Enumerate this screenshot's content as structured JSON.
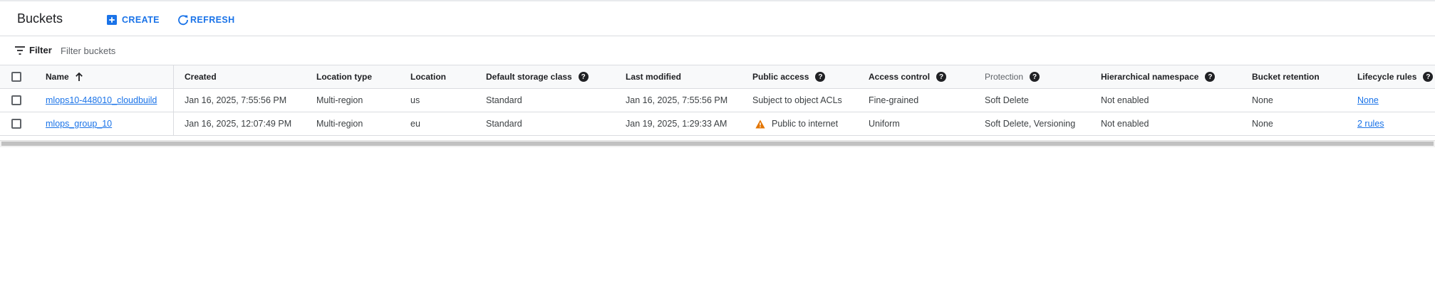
{
  "header": {
    "title": "Buckets",
    "create_label": "CREATE",
    "refresh_label": "REFRESH"
  },
  "filter": {
    "label": "Filter",
    "placeholder": "Filter buckets"
  },
  "table": {
    "columns": [
      "Name",
      "Created",
      "Location type",
      "Location",
      "Default storage class",
      "Last modified",
      "Public access",
      "Access control",
      "Protection",
      "Hierarchical namespace",
      "Bucket retention",
      "Lifecycle rules"
    ],
    "sorted_column": "Name",
    "sort_direction": "ascending",
    "rows": [
      {
        "name": "mlops10-448010_cloudbuild",
        "created": "Jan 16, 2025, 7:55:56 PM",
        "location_type": "Multi-region",
        "location": "us",
        "storage_class": "Standard",
        "last_modified": "Jan 16, 2025, 7:55:56 PM",
        "public_access": "Subject to object ACLs",
        "access_control": "Fine-grained",
        "protection": "Soft Delete",
        "hierarchical_namespace": "Not enabled",
        "bucket_retention": "None",
        "lifecycle_rules": "None"
      },
      {
        "name": "mlops_group_10",
        "created": "Jan 16, 2025, 12:07:49 PM",
        "location_type": "Multi-region",
        "location": "eu",
        "storage_class": "Standard",
        "last_modified": "Jan 19, 2025, 1:29:33 AM",
        "public_access": "Public to internet",
        "access_control": "Uniform",
        "protection": "Soft Delete, Versioning",
        "hierarchical_namespace": "Not enabled",
        "bucket_retention": "None",
        "lifecycle_rules": "2 rules"
      }
    ]
  },
  "colors": {
    "accent": "#1a73e8",
    "warning": "#e37400",
    "border": "#dadce0"
  },
  "icons": {
    "create": "add-box-icon",
    "refresh": "refresh-icon",
    "filter": "filter-list-icon",
    "sort": "arrow-up-icon",
    "help": "help-icon",
    "warning": "warning-icon"
  }
}
